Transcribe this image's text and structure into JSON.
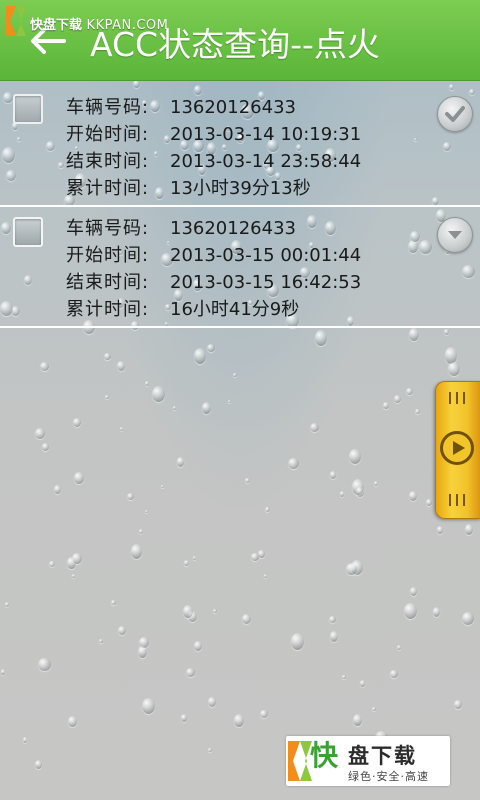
{
  "watermark": {
    "text": "快盘下载",
    "domain": "KKPAN.COM"
  },
  "header": {
    "title": "ACC状态查询--点火",
    "back_icon": "arrow-left-icon",
    "color": "#5fb83c"
  },
  "records": [
    {
      "plate_label": "车辆号码:",
      "plate": "13620126433",
      "start_label": "开始时间:",
      "start": "2013-03-14 10:19:31",
      "end_label": "结束时间:",
      "end": "2013-03-14 23:58:44",
      "duration_label": "累计时间:",
      "duration": "13小时39分13秒"
    },
    {
      "plate_label": "车辆号码:",
      "plate": "13620126433",
      "start_label": "开始时间:",
      "start": "2013-03-15 00:01:44",
      "end_label": "结束时间:",
      "end": "2013-03-15 16:42:53",
      "duration_label": "累计时间:",
      "duration": "16小时41分9秒"
    }
  ],
  "side_handle": {
    "icon": "play-icon",
    "color": "#f5c52a"
  },
  "brand": {
    "kuai": "快",
    "name": "盘下载",
    "slogan": "绿色·安全·高速",
    "color": "#3aa232"
  }
}
